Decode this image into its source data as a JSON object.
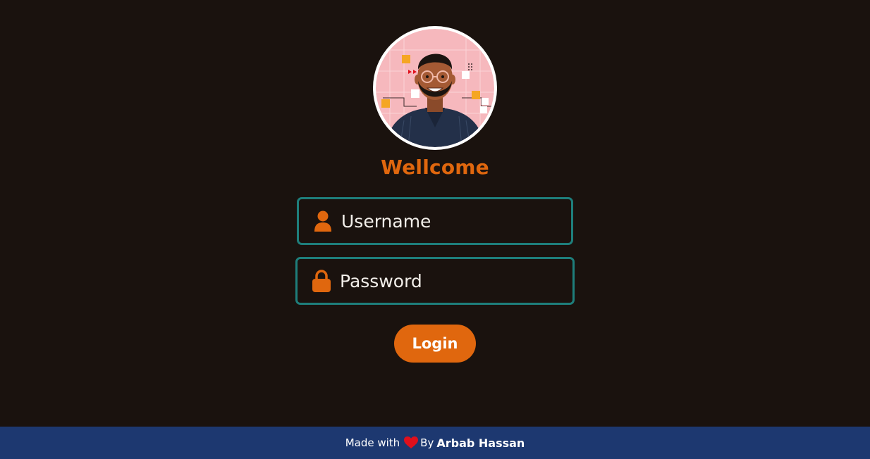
{
  "welcome": {
    "title": "Wellcome"
  },
  "avatar": {
    "alt": "User avatar illustration"
  },
  "form": {
    "username_placeholder": "Username",
    "password_placeholder": "Password",
    "login_label": "Login"
  },
  "footer": {
    "made_with": "Made with",
    "by": "By",
    "author": "Arbab Hassan"
  },
  "icons": {
    "username": "user-icon",
    "password": "lock-icon",
    "heart": "heart-icon"
  },
  "colors": {
    "background": "#1a120e",
    "accent": "#e0670e",
    "field_border": "#1e7e7b",
    "footer": "#1d3870",
    "heart": "#e0101c"
  }
}
